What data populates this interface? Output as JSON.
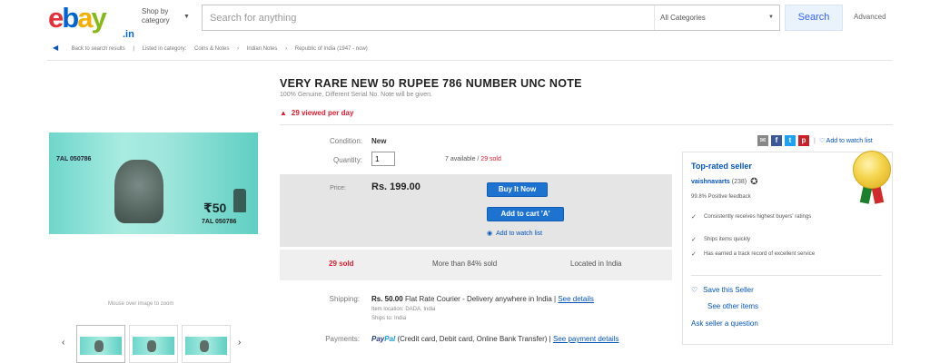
{
  "header": {
    "logo_letters": [
      "e",
      "b",
      "a",
      "y"
    ],
    "logo_suffix": ".in",
    "shop_by_line1": "Shop by",
    "shop_by_line2": "category",
    "search_placeholder": "Search for anything",
    "category_select": "All Categories",
    "search_button": "Search",
    "advanced_link": "Advanced"
  },
  "breadcrumb": {
    "back": "Back to search results",
    "listed_in": "Listed in category:",
    "items": [
      "Coins & Notes",
      "Indian Notes",
      "Republic of India (1947 - now)"
    ]
  },
  "listing": {
    "title": "VERY RARE NEW 50 RUPEE 786 NUMBER UNC NOTE",
    "subtitle": "100% Genuine, Different Serial No. Note will be given.",
    "viewed": "29 viewed per day",
    "condition_label": "Condition:",
    "condition_value": "New",
    "quantity_label": "Quantity:",
    "quantity_value": "1",
    "available": "7 available",
    "available_sep": " / ",
    "sold": "29 sold",
    "price_label": "Price:",
    "price_value": "Rs. 199.00",
    "buy_it_now": "Buy It Now",
    "add_to_cart": "Add to cart 'A'",
    "add_to_watch": "Add to watch list",
    "stats": {
      "sold": "29 sold",
      "more_than": "More than 84% sold",
      "located": "Located in India"
    },
    "shipping_label": "Shipping:",
    "shipping_price": "Rs. 50.00",
    "shipping_desc": "Flat Rate Courier - Delivery anywhere in India",
    "shipping_details_link": "See details",
    "shipping_location": "Item location: DADA, India",
    "ships_to": "Ships to: India",
    "payments_label": "Payments:",
    "paypal_pay": "Pay",
    "paypal_pal": "Pal",
    "payments_desc": "(Credit card, Debit card, Online Bank Transfer)",
    "payments_sep": "|",
    "payments_link": "See payment details"
  },
  "gallery": {
    "hover_text": "Mouse over image to zoom",
    "note_value": "₹50",
    "note_serial": "7AL 050786",
    "note_serial_left": "7AL 050786",
    "prev_arrow": "‹",
    "next_arrow": "›",
    "thumb_count": 3
  },
  "seller": {
    "share_watch": "Add to watch list",
    "title": "Top-rated seller",
    "name": "vaishnavarts",
    "score": "(238)",
    "feedback": "99.8% Positive feedback",
    "bullets": [
      "Consistently receives highest buyers' ratings",
      "Ships items quickly",
      "Has earned a track record of excellent service"
    ],
    "save_seller": "Save this Seller",
    "see_other": "See other items",
    "ask_seller": "Ask seller a question"
  },
  "colors": {
    "ebay_red": "#e53238",
    "ebay_blue": "#0064d2",
    "ebay_yellow": "#f5af02",
    "ebay_green": "#86b817",
    "link_blue": "#0654ba",
    "button_blue": "#1e73d0",
    "alert_red": "#dd1e31"
  }
}
